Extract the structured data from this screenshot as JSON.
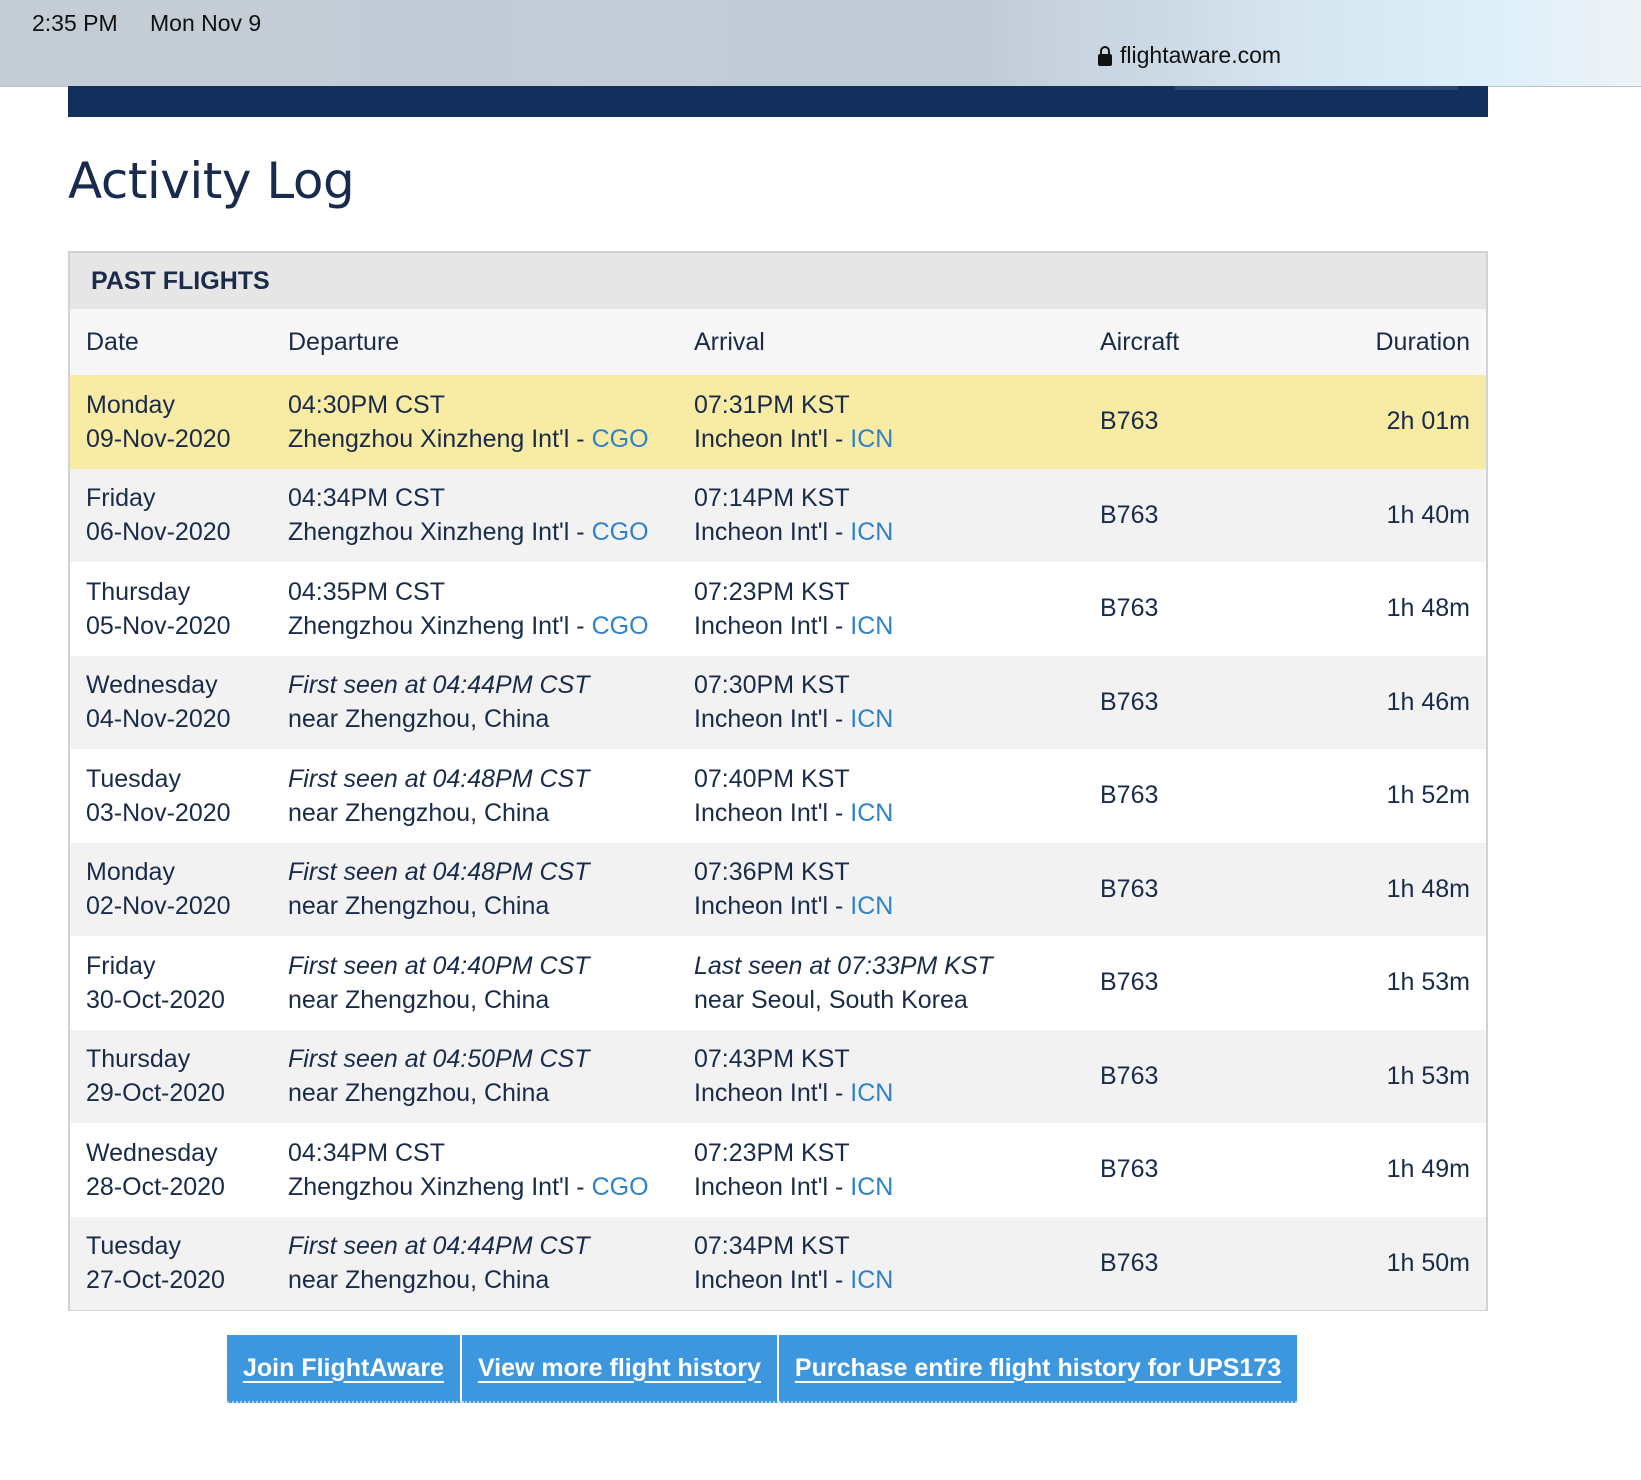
{
  "status_bar": {
    "time": "2:35 PM",
    "date": "Mon Nov 9"
  },
  "browser": {
    "url": "flightaware.com",
    "lock_icon": "lock-icon"
  },
  "page": {
    "title": "Activity Log"
  },
  "past_flights": {
    "header": "PAST FLIGHTS",
    "columns": [
      "Date",
      "Departure",
      "Arrival",
      "Aircraft",
      "Duration"
    ],
    "rows": [
      {
        "day": "Monday",
        "date": "09-Nov-2020",
        "dep_line1": "04:30PM CST",
        "dep_name": "Zhengzhou Xinzheng Int'l - ",
        "dep_code": "CGO",
        "arr_line1": "07:31PM KST",
        "arr_name": "Incheon Int'l - ",
        "arr_code": "ICN",
        "aircraft": "B763",
        "duration": "2h 01m"
      },
      {
        "day": "Friday",
        "date": "06-Nov-2020",
        "dep_line1": "04:34PM CST",
        "dep_name": "Zhengzhou Xinzheng Int'l - ",
        "dep_code": "CGO",
        "arr_line1": "07:14PM KST",
        "arr_name": "Incheon Int'l - ",
        "arr_code": "ICN",
        "aircraft": "B763",
        "duration": "1h 40m"
      },
      {
        "day": "Thursday",
        "date": "05-Nov-2020",
        "dep_line1": "04:35PM CST",
        "dep_name": "Zhengzhou Xinzheng Int'l - ",
        "dep_code": "CGO",
        "arr_line1": "07:23PM KST",
        "arr_name": "Incheon Int'l - ",
        "arr_code": "ICN",
        "aircraft": "B763",
        "duration": "1h 48m"
      },
      {
        "day": "Wednesday",
        "date": "04-Nov-2020",
        "dep_line1": "First seen at 04:44PM CST",
        "dep_name": "near Zhengzhou, China",
        "dep_code": "",
        "arr_line1": "07:30PM KST",
        "arr_name": "Incheon Int'l - ",
        "arr_code": "ICN",
        "aircraft": "B763",
        "duration": "1h 46m"
      },
      {
        "day": "Tuesday",
        "date": "03-Nov-2020",
        "dep_line1": "First seen at 04:48PM CST",
        "dep_name": "near Zhengzhou, China",
        "dep_code": "",
        "arr_line1": "07:40PM KST",
        "arr_name": "Incheon Int'l - ",
        "arr_code": "ICN",
        "aircraft": "B763",
        "duration": "1h 52m"
      },
      {
        "day": "Monday",
        "date": "02-Nov-2020",
        "dep_line1": "First seen at 04:48PM CST",
        "dep_name": "near Zhengzhou, China",
        "dep_code": "",
        "arr_line1": "07:36PM KST",
        "arr_name": "Incheon Int'l - ",
        "arr_code": "ICN",
        "aircraft": "B763",
        "duration": "1h 48m"
      },
      {
        "day": "Friday",
        "date": "30-Oct-2020",
        "dep_line1": "First seen at 04:40PM CST",
        "dep_name": "near Zhengzhou, China",
        "dep_code": "",
        "arr_line1": "Last seen at 07:33PM KST",
        "arr_name": "near Seoul, South Korea",
        "arr_code": "",
        "aircraft": "B763",
        "duration": "1h 53m"
      },
      {
        "day": "Thursday",
        "date": "29-Oct-2020",
        "dep_line1": "First seen at 04:50PM CST",
        "dep_name": "near Zhengzhou, China",
        "dep_code": "",
        "arr_line1": "07:43PM KST",
        "arr_name": "Incheon Int'l - ",
        "arr_code": "ICN",
        "aircraft": "B763",
        "duration": "1h 53m"
      },
      {
        "day": "Wednesday",
        "date": "28-Oct-2020",
        "dep_line1": "04:34PM CST",
        "dep_name": "Zhengzhou Xinzheng Int'l - ",
        "dep_code": "CGO",
        "arr_line1": "07:23PM KST",
        "arr_name": "Incheon Int'l - ",
        "arr_code": "ICN",
        "aircraft": "B763",
        "duration": "1h 49m"
      },
      {
        "day": "Tuesday",
        "date": "27-Oct-2020",
        "dep_line1": "First seen at 04:44PM CST",
        "dep_name": "near Zhengzhou, China",
        "dep_code": "",
        "arr_line1": "07:34PM KST",
        "arr_name": "Incheon Int'l - ",
        "arr_code": "ICN",
        "aircraft": "B763",
        "duration": "1h 50m"
      }
    ]
  },
  "actions": {
    "join": "Join FlightAware",
    "more_history": "View more flight history",
    "purchase": "Purchase entire flight history for UPS173"
  },
  "colors": {
    "navbar": "#132f5c",
    "highlight_row": "#f8eba4",
    "link": "#2f82c9",
    "button": "#3d97de"
  }
}
